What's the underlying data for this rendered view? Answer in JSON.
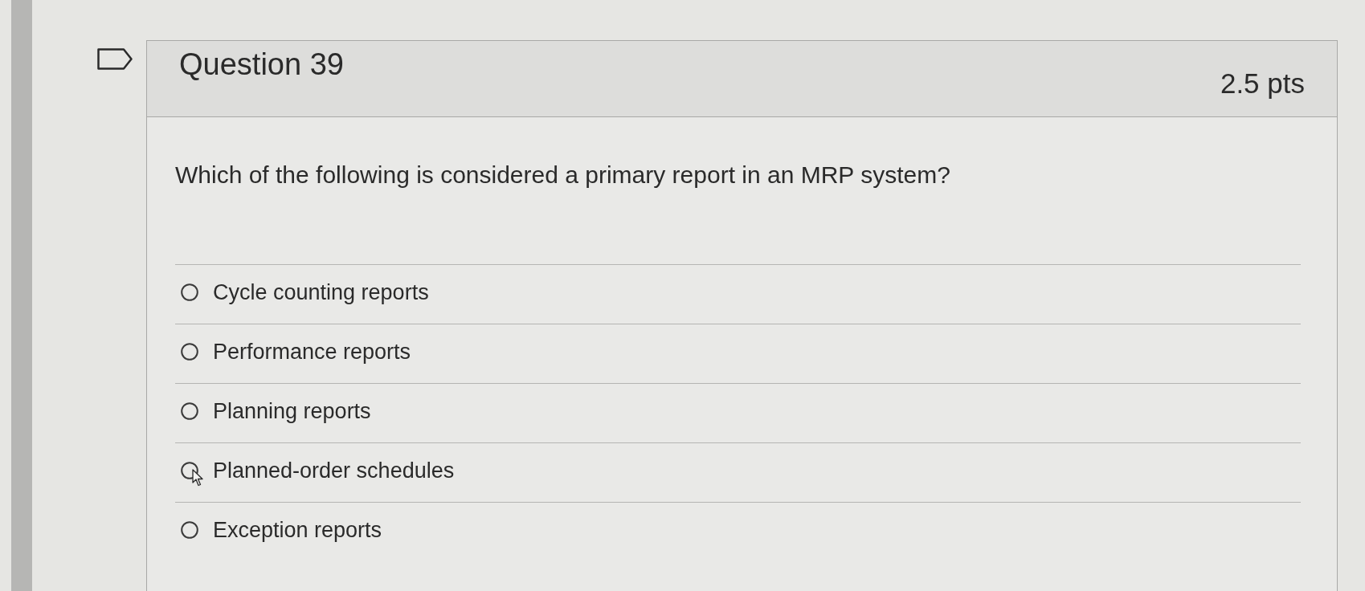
{
  "question": {
    "title": "Question 39",
    "points": "2.5 pts",
    "flagged": false,
    "text": "Which of the following is considered a primary report in an MRP system?",
    "answers": [
      {
        "label": "Cycle counting reports",
        "selected": false,
        "pointer": false
      },
      {
        "label": "Performance reports",
        "selected": false,
        "pointer": false
      },
      {
        "label": "Planning reports",
        "selected": false,
        "pointer": false
      },
      {
        "label": "Planned-order schedules",
        "selected": false,
        "pointer": true
      },
      {
        "label": "Exception reports",
        "selected": false,
        "pointer": false
      }
    ]
  }
}
